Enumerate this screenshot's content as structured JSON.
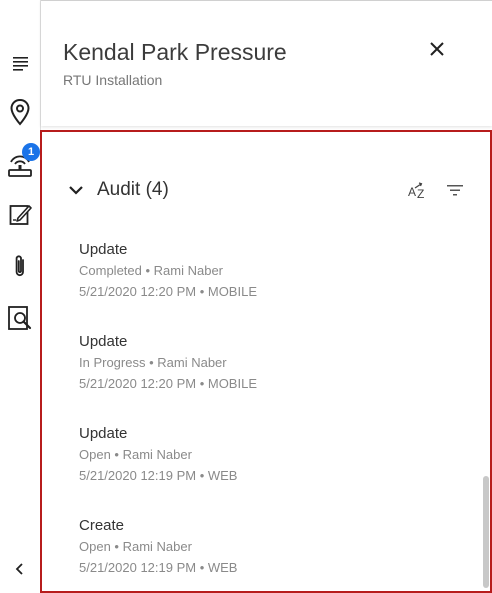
{
  "header": {
    "title": "Kendal Park Pressure",
    "subtitle": "RTU Installation"
  },
  "rail": {
    "items": [
      {
        "icon": "list-icon"
      },
      {
        "icon": "location-pin-icon"
      },
      {
        "icon": "rtu-device-icon",
        "badge": "1"
      },
      {
        "icon": "edit-note-icon"
      },
      {
        "icon": "paperclip-icon"
      },
      {
        "icon": "document-search-icon"
      }
    ],
    "collapse_icon": "chevron-left-icon"
  },
  "audit": {
    "title": "Audit (4)",
    "entries": [
      {
        "action": "Update",
        "status_line": "Completed • Rami Naber",
        "time_line": "5/21/2020 12:20 PM • MOBILE"
      },
      {
        "action": "Update",
        "status_line": "In Progress • Rami Naber",
        "time_line": "5/21/2020 12:20 PM • MOBILE"
      },
      {
        "action": "Update",
        "status_line": "Open • Rami Naber",
        "time_line": "5/21/2020 12:19 PM • WEB"
      },
      {
        "action": "Create",
        "status_line": "Open • Rami Naber",
        "time_line": "5/21/2020 12:19 PM • WEB"
      }
    ]
  },
  "colors": {
    "accent": "#1a73e8",
    "panel_border": "#b71c1c",
    "icon": "#212121"
  }
}
